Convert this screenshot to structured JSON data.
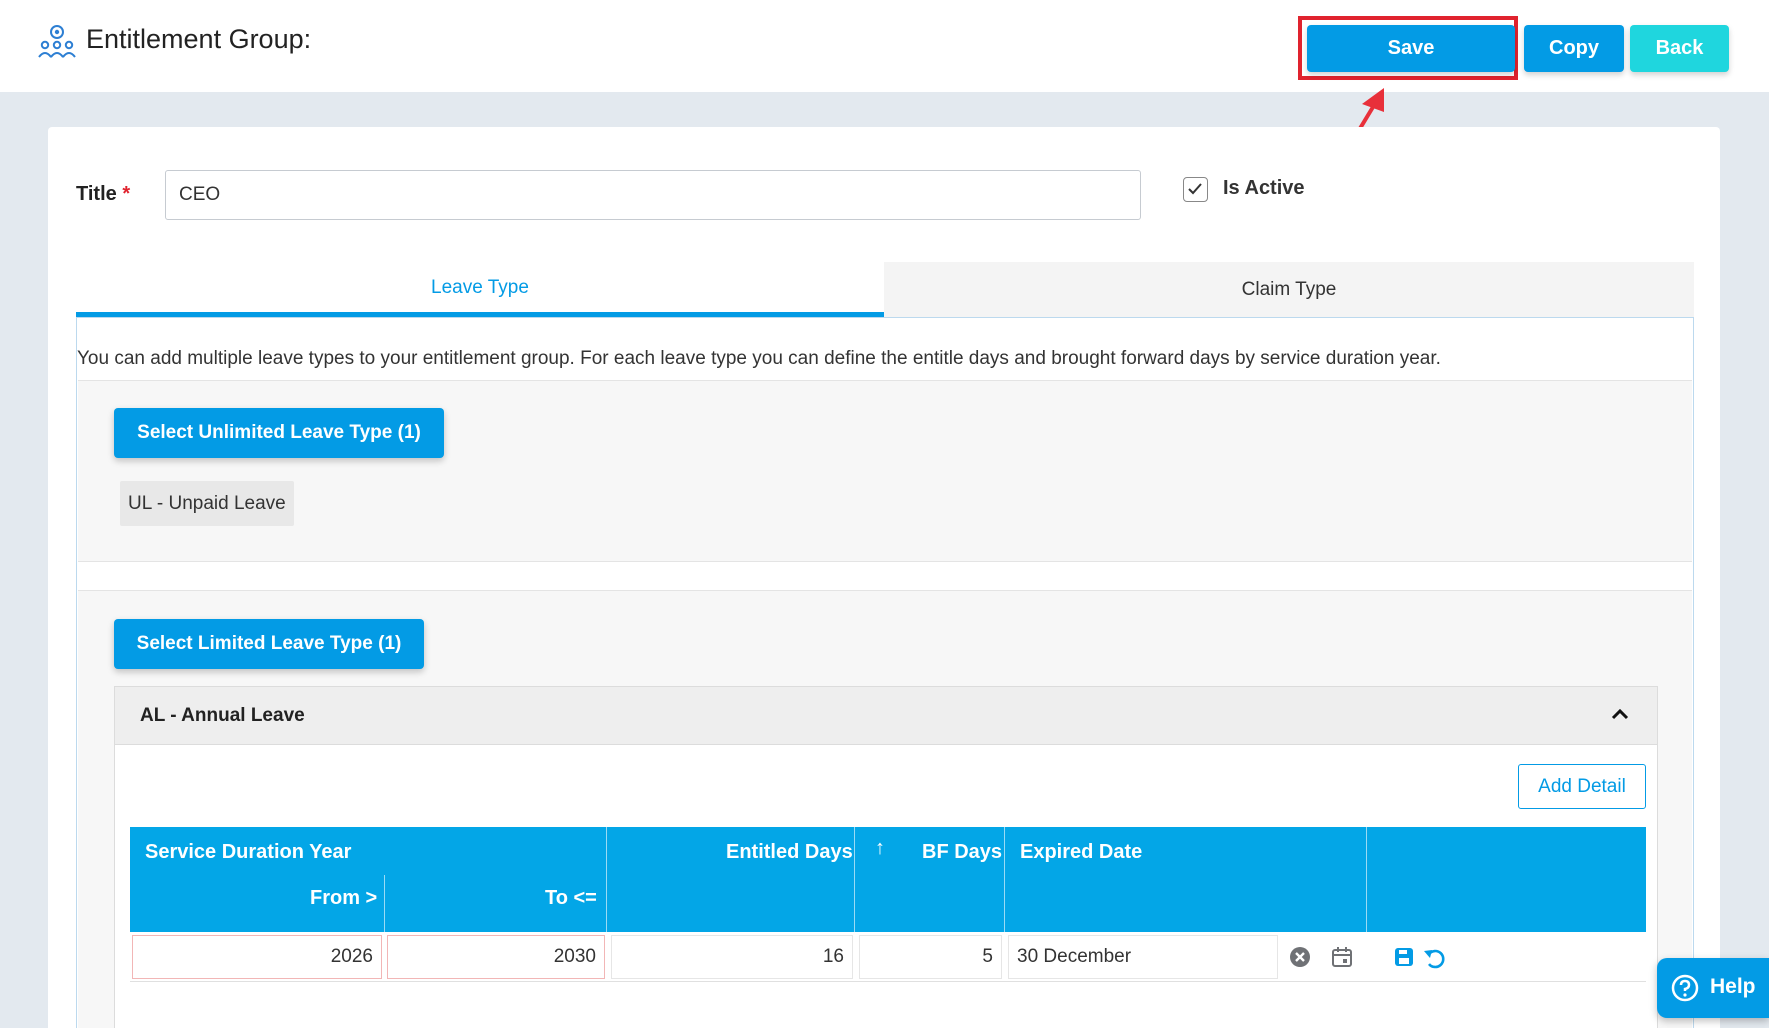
{
  "header": {
    "title": "Entitlement Group:",
    "save_label": "Save",
    "copy_label": "Copy",
    "back_label": "Back"
  },
  "form": {
    "title_label": "Title",
    "required_mark": "*",
    "title_value": "CEO",
    "is_active_label": "Is Active",
    "is_active_checked": true
  },
  "tabs": [
    {
      "label": "Leave Type",
      "active": true
    },
    {
      "label": "Claim Type",
      "active": false
    }
  ],
  "leave_panel": {
    "description": "You can add multiple leave types to your entitlement group. For each leave type you can define the entitle days and brought forward days by service duration year.",
    "unlimited_button": "Select Unlimited Leave Type (1)",
    "unlimited_items": [
      "UL - Unpaid Leave"
    ],
    "limited_button": "Select Limited Leave Type (1)",
    "limited_group": {
      "title": "AL - Annual Leave",
      "add_detail_label": "Add Detail",
      "columns": {
        "service_duration_year": "Service Duration Year",
        "from": "From >",
        "to": "To <=",
        "entitled_days": "Entitled Days",
        "sort_arrow": "↑",
        "bf_days": "BF Days",
        "expired_date": "Expired Date"
      },
      "rows": [
        {
          "from": "2026",
          "to": "2030",
          "entitled_days": "16",
          "bf_days": "5",
          "expired_date": "30 December"
        }
      ]
    }
  },
  "help": {
    "label": "Help"
  },
  "colors": {
    "primary": "#039be5",
    "back_button": "#1fd6de",
    "highlight": "#e0232e"
  },
  "icons": [
    "entitlement-group-icon",
    "check-icon",
    "chevron-up-icon",
    "clear-circle-icon",
    "calendar-icon",
    "save-disk-icon",
    "undo-icon",
    "help-circle-icon",
    "annotation-arrow"
  ]
}
